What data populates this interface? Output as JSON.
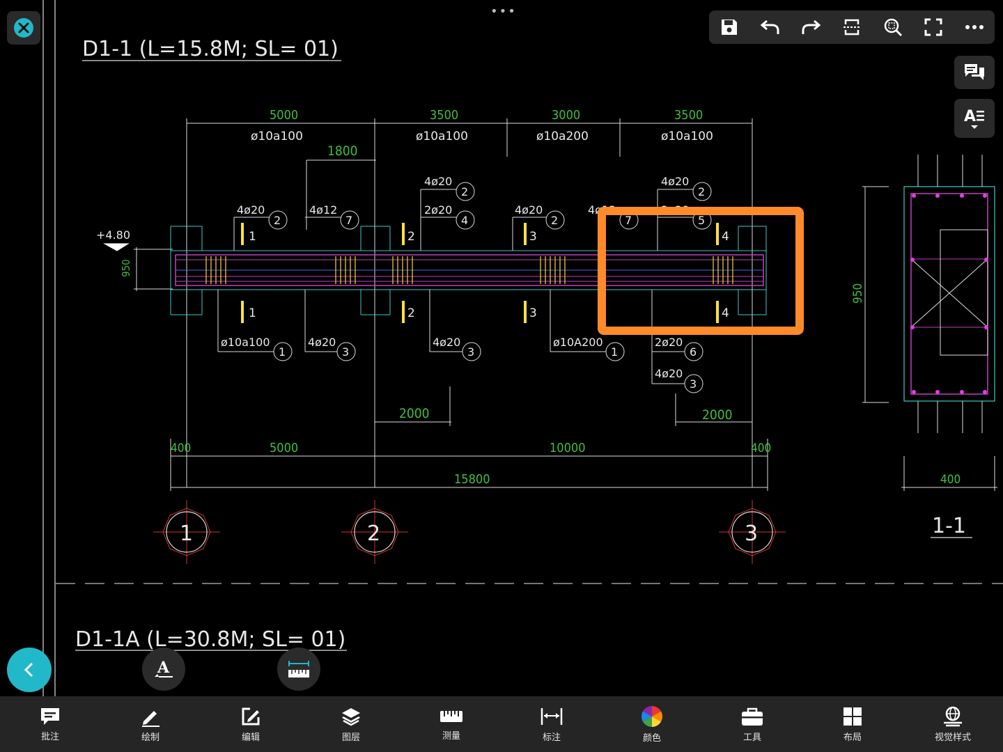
{
  "drawing": {
    "title1": "D1-1 (L=15.8M; SL= 01)",
    "title2": "D1-1A (L=30.8M; SL= 01)",
    "section_label": "1-1",
    "elevation": "+4.80",
    "dims_top": [
      "5000",
      "3500",
      "3000",
      "3500"
    ],
    "stirrups_top": [
      "ø10a100",
      "ø10a100",
      "ø10a200",
      "ø10a100"
    ],
    "dim_1800": "1800",
    "callouts": [
      {
        "text": "4ø20",
        "num": "2"
      },
      {
        "text": "4ø12",
        "num": "7"
      },
      {
        "text": "4ø20",
        "num": "2"
      },
      {
        "text": "2ø20",
        "num": "4"
      },
      {
        "text": "4ø20",
        "num": "2"
      },
      {
        "text": "4ø12",
        "num": "7"
      },
      {
        "text": "4ø20",
        "num": "2"
      },
      {
        "text": "2ø20",
        "num": "5"
      }
    ],
    "callouts_bottom": [
      {
        "text": "ø10a100",
        "num": "1"
      },
      {
        "text": "4ø20",
        "num": "3"
      },
      {
        "text": "4ø20",
        "num": "3"
      },
      {
        "text": "ø10A200",
        "num": "1"
      },
      {
        "text": "2ø20",
        "num": "6"
      },
      {
        "text": "4ø20",
        "num": "3"
      }
    ],
    "section_marks": [
      "1",
      "2",
      "3",
      "4"
    ],
    "height_950": "950",
    "dim_2000a": "2000",
    "dim_2000b": "2000",
    "dims_bottom": [
      "400",
      "5000",
      "10000",
      "400"
    ],
    "total": "15800",
    "axes": [
      "1",
      "2",
      "3"
    ],
    "section_950": "950",
    "section_400": "400"
  },
  "top_toolbar": {
    "icons": [
      "save-icon",
      "undo-icon",
      "redo-icon",
      "scan-select-icon",
      "zoom-extent-icon",
      "fullscreen-icon",
      "more-icon"
    ]
  },
  "bottom_bar": [
    {
      "name": "annotate",
      "label": "批注"
    },
    {
      "name": "draw",
      "label": "绘制"
    },
    {
      "name": "edit",
      "label": "编辑"
    },
    {
      "name": "layers",
      "label": "图层"
    },
    {
      "name": "measure",
      "label": "测量"
    },
    {
      "name": "dimension",
      "label": "标注"
    },
    {
      "name": "color",
      "label": "颜色"
    },
    {
      "name": "tools",
      "label": "工具"
    },
    {
      "name": "layout",
      "label": "布局"
    },
    {
      "name": "visual-style",
      "label": "视觉样式"
    }
  ],
  "colors": {
    "accent": "#21b8c9",
    "highlight": "#ff8a2a",
    "dim_green": "#3fbf3f",
    "beam_magenta": "#c040c0"
  }
}
